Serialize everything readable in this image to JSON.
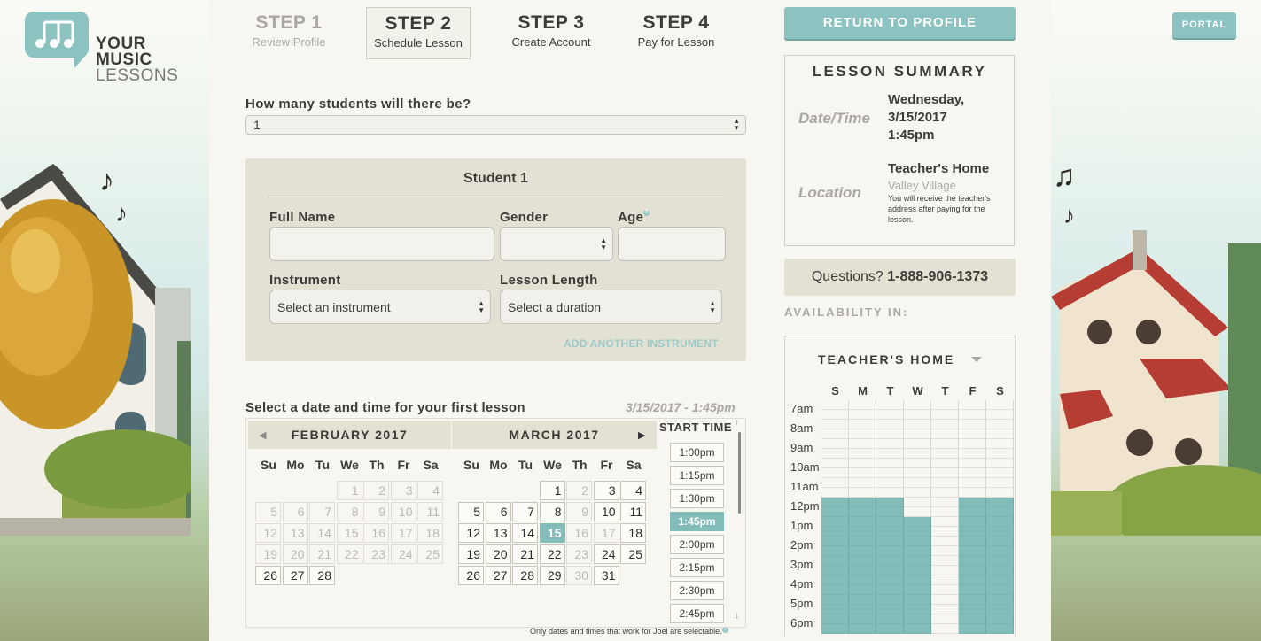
{
  "logo": {
    "line1": "YOUR",
    "line2": "MUSIC",
    "line3": "LESSONS"
  },
  "steps": [
    {
      "num": "STEP 1",
      "label": "Review Profile"
    },
    {
      "num": "STEP 2",
      "label": "Schedule Lesson"
    },
    {
      "num": "STEP 3",
      "label": "Create Account"
    },
    {
      "num": "STEP 4",
      "label": "Pay for Lesson"
    }
  ],
  "form": {
    "students_question": "How many students will there be?",
    "students_value": "1",
    "student_title": "Student 1",
    "full_name_label": "Full Name",
    "gender_label": "Gender",
    "age_label": "Age",
    "help_glyph": "?",
    "instrument_label": "Instrument",
    "instrument_value": "Select an instrument",
    "length_label": "Lesson Length",
    "length_value": "Select a duration",
    "add_instrument": "ADD ANOTHER INSTRUMENT"
  },
  "calendar": {
    "prompt": "Select a date and time for your first lesson",
    "selected_summary": "3/15/2017 - 1:45pm",
    "month1": "FEBRUARY 2017",
    "month2": "MARCH 2017",
    "weekdays": [
      "Su",
      "Mo",
      "Tu",
      "We",
      "Th",
      "Fr",
      "Sa"
    ],
    "start_time_title": "START TIME",
    "times": [
      "1:00pm",
      "1:15pm",
      "1:30pm",
      "1:45pm",
      "2:00pm",
      "2:15pm",
      "2:30pm",
      "2:45pm"
    ],
    "selected_time": "1:45pm",
    "footnote": "Only dates and times that work for Joel are selectable."
  },
  "right": {
    "return_button": "RETURN TO PROFILE",
    "portal_button": "PORTAL",
    "summary_title": "LESSON SUMMARY",
    "datetime_key": "Date/Time",
    "datetime_line1": "Wednesday,",
    "datetime_line2": "3/15/2017",
    "datetime_line3": "1:45pm",
    "location_key": "Location",
    "location_value": "Teacher's Home",
    "location_sub": "Valley Village",
    "location_note": "You will receive the teacher's address after paying for the lesson.",
    "questions_prefix": "Questions? ",
    "questions_phone": "1-888-906-1373",
    "availability_label": "AVAILABILITY IN:",
    "availability_place": "TEACHER'S HOME",
    "grid_days": [
      "S",
      "M",
      "T",
      "W",
      "T",
      "F",
      "S"
    ],
    "grid_hours": [
      "7am",
      "8am",
      "9am",
      "10am",
      "11am",
      "12pm",
      "1pm",
      "2pm",
      "3pm",
      "4pm",
      "5pm",
      "6pm"
    ]
  },
  "colors": {
    "accent": "#8cc3c0",
    "selected": "#83bdb9",
    "panel": "#e3e1d3"
  }
}
